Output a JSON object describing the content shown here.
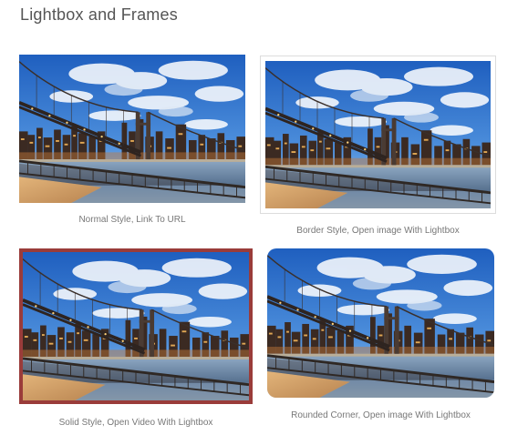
{
  "page": {
    "title": "Lightbox and Frames"
  },
  "items": [
    {
      "caption": "Normal Style, Link To URL",
      "frame_style": "normal"
    },
    {
      "caption": "Border Style, Open image With Lightbox",
      "frame_style": "border"
    },
    {
      "caption": "Solid Style, Open Video With Lightbox",
      "frame_style": "solid",
      "border_color": "#9a3c3a"
    },
    {
      "caption": "Rounded Corner, Open image With Lightbox",
      "frame_style": "rounded"
    }
  ],
  "colors": {
    "title": "#555555",
    "caption": "#777777",
    "solid_border": "#9a3c3a",
    "thin_border": "#dcdcdc"
  }
}
